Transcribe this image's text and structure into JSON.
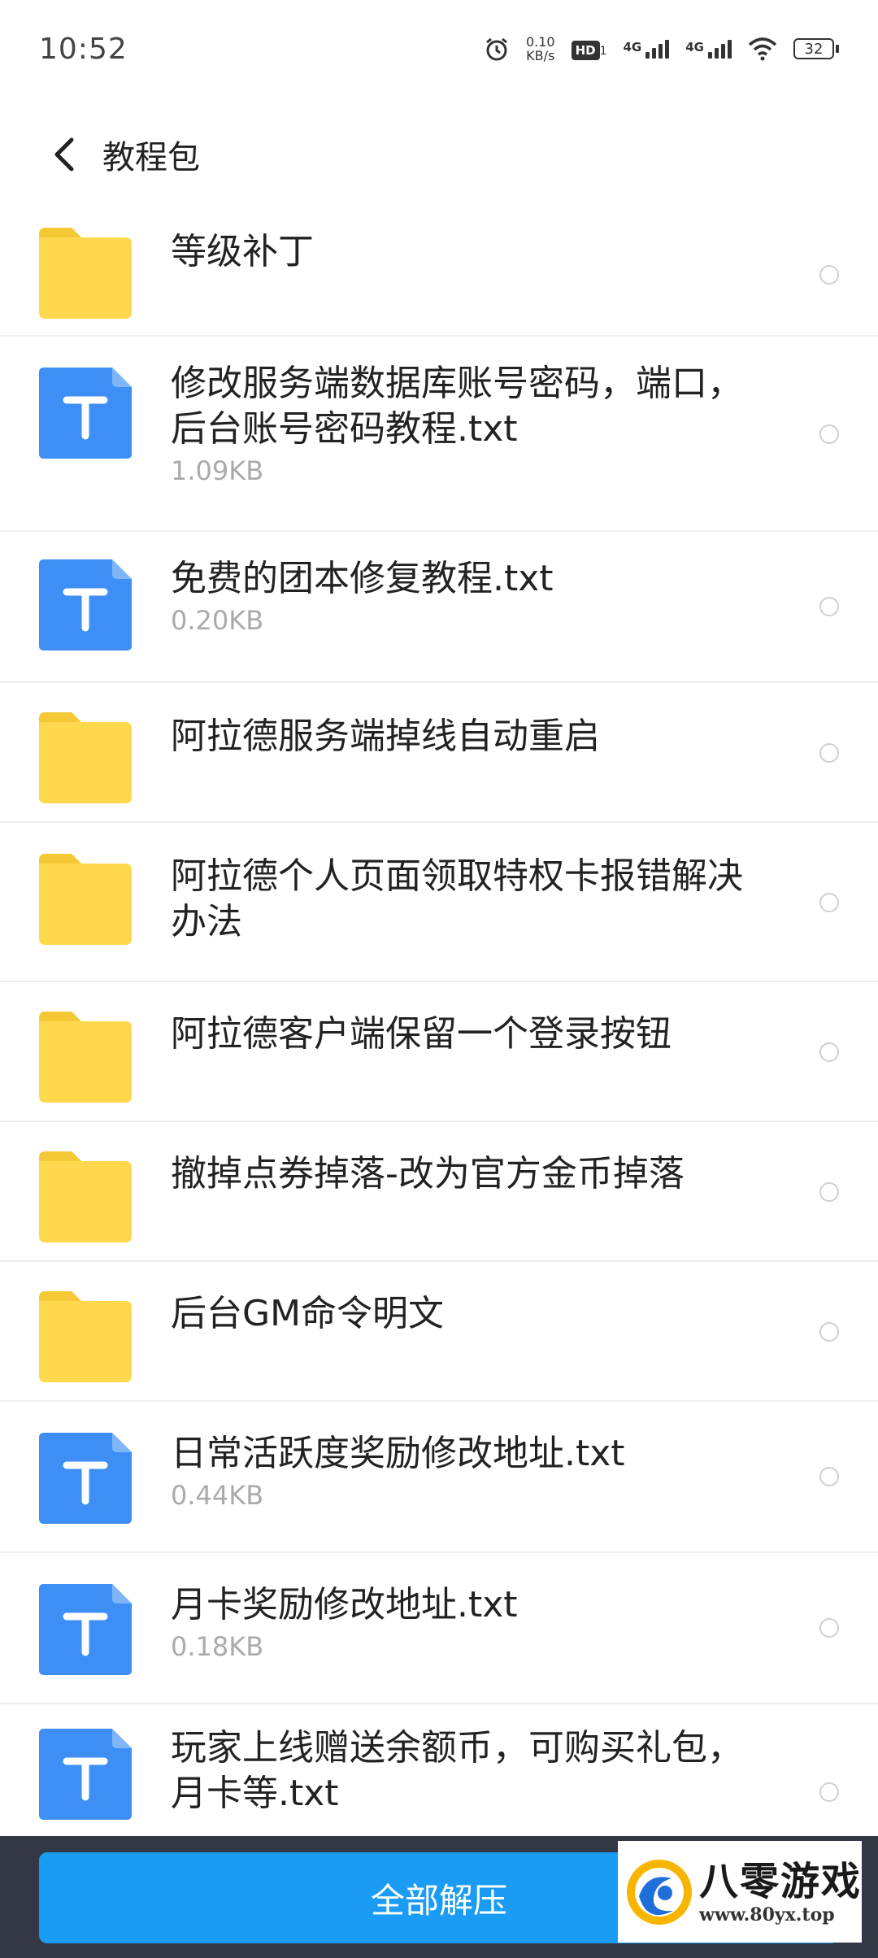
{
  "status_bar": {
    "time": "10:52",
    "net_speed_value": "0.10",
    "net_speed_unit": "KB/s",
    "hd_label": "HD",
    "hd_sub": "1",
    "sim1_label": "4G",
    "sim2_label": "4G",
    "battery": "32"
  },
  "header": {
    "title": "教程包"
  },
  "files": [
    {
      "name": "等级补丁",
      "type": "folder",
      "size": ""
    },
    {
      "name": "修改服务端数据库账号密码，端口，后台账号密码教程.txt",
      "type": "txt",
      "size": "1.09KB"
    },
    {
      "name": "免费的团本修复教程.txt",
      "type": "txt",
      "size": "0.20KB"
    },
    {
      "name": "阿拉德服务端掉线自动重启",
      "type": "folder",
      "size": ""
    },
    {
      "name": "阿拉德个人页面领取特权卡报错解决办法",
      "type": "folder",
      "size": ""
    },
    {
      "name": "阿拉德客户端保留一个登录按钮",
      "type": "folder",
      "size": ""
    },
    {
      "name": "撤掉点券掉落-改为官方金币掉落",
      "type": "folder",
      "size": ""
    },
    {
      "name": "后台GM命令明文",
      "type": "folder",
      "size": ""
    },
    {
      "name": "日常活跃度奖励修改地址.txt",
      "type": "txt",
      "size": "0.44KB"
    },
    {
      "name": "月卡奖励修改地址.txt",
      "type": "txt",
      "size": "0.18KB"
    },
    {
      "name": "玩家上线赠送余额币，可购买礼包，月卡等.txt",
      "type": "txt",
      "size": ""
    }
  ],
  "bottom": {
    "extract_all_label": "全部解压"
  },
  "watermark": {
    "title": "八零游戏",
    "url": "www.80yx.top"
  },
  "colors": {
    "folder": "#ffd84d",
    "folder_tab": "#f5c935",
    "txt": "#3d8ff5",
    "accent": "#1a9cf4",
    "bottom_bar": "#333844"
  }
}
